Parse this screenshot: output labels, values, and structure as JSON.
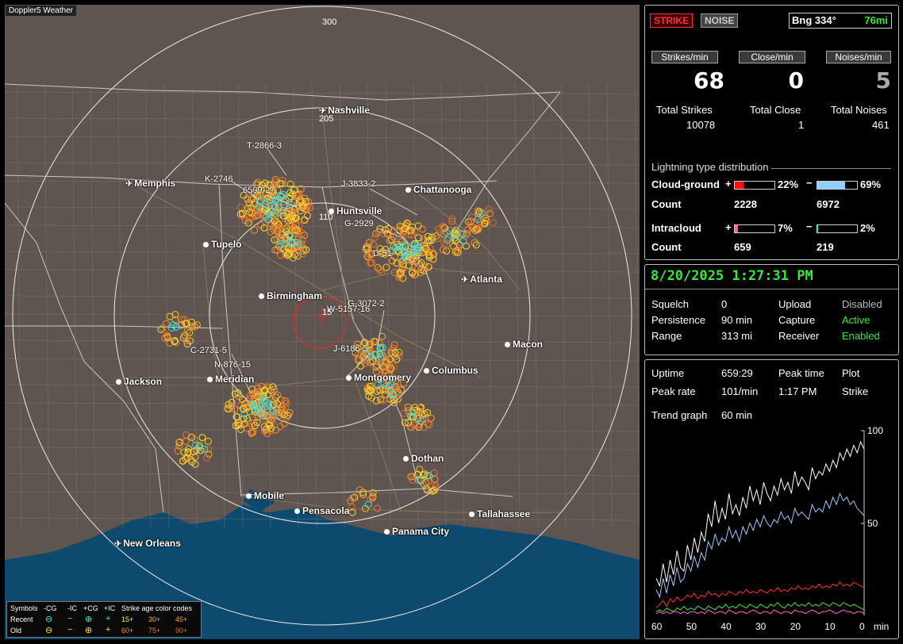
{
  "brand": "Doppler5 Weather",
  "map": {
    "range_rings": [
      "300",
      "205",
      "110",
      "15"
    ],
    "cities": [
      {
        "name": "Nashville",
        "type": "airport"
      },
      {
        "name": "Memphis",
        "type": "airport"
      },
      {
        "name": "Chattanooga",
        "type": "city"
      },
      {
        "name": "Huntsville",
        "type": "city"
      },
      {
        "name": "Tupelo",
        "type": "city"
      },
      {
        "name": "Atlanta",
        "type": "airport"
      },
      {
        "name": "Birmingham",
        "type": "city"
      },
      {
        "name": "Macon",
        "type": "city"
      },
      {
        "name": "Jackson",
        "type": "city"
      },
      {
        "name": "Meridian",
        "type": "city"
      },
      {
        "name": "Montgomery",
        "type": "city"
      },
      {
        "name": "Columbus",
        "type": "city"
      },
      {
        "name": "Dothan",
        "type": "city"
      },
      {
        "name": "Mobile",
        "type": "city"
      },
      {
        "name": "Pensacola",
        "type": "city"
      },
      {
        "name": "Tallahassee",
        "type": "city"
      },
      {
        "name": "Panama City",
        "type": "city"
      },
      {
        "name": "New Orleans",
        "type": "airport"
      }
    ],
    "tracks": [
      "T-2866-3",
      "K-2746",
      "6599-27",
      "J-3833-2",
      "G-2929",
      "D-51",
      "G-3072-2",
      "W-5157-16",
      "J-6186-5",
      "C-2731-5",
      "N-876-15"
    ]
  },
  "legend": {
    "row0": [
      "Symbols",
      "-CG",
      "-IC",
      "+CG",
      "+IC",
      "Strike age color codes"
    ],
    "recent_label": "Recent",
    "old_label": "Old",
    "recent_ages": [
      "15+",
      "30+",
      "45+"
    ],
    "old_ages": [
      "60+",
      "75+",
      "90+"
    ]
  },
  "status": {
    "strike_btn": "STRIKE",
    "noise_btn": "NOISE",
    "bearing": "Bng 334°",
    "distance": "76mi",
    "cols": [
      {
        "caption": "Strikes/min",
        "value": "68",
        "total_label": "Total Strikes",
        "total": "10078"
      },
      {
        "caption": "Close/min",
        "value": "0",
        "total_label": "Total Close",
        "total": "1"
      },
      {
        "caption": "Noises/min",
        "value": "5",
        "total_label": "Total Noises",
        "total": "461"
      }
    ],
    "dist_title": "Lightning type distribution",
    "cg_label": "Cloud-ground",
    "ic_label": "Intracloud",
    "count_label": "Count",
    "cg_pos_pct": "22%",
    "cg_neg_pct": "69%",
    "cg_pos_count": "2228",
    "cg_neg_count": "6972",
    "ic_pos_pct": "7%",
    "ic_neg_pct": "2%",
    "ic_pos_count": "659",
    "ic_neg_count": "219",
    "cg_pos_frac": 0.22,
    "cg_neg_frac": 0.69,
    "ic_pos_frac": 0.07,
    "ic_neg_frac": 0.02
  },
  "settings": {
    "datetime": "8/20/2025 1:27:31 PM",
    "squelch_label": "Squelch",
    "squelch": "0",
    "persistence_label": "Persistence",
    "persistence": "90 min",
    "range_label": "Range",
    "range": "313 mi",
    "upload_label": "Upload",
    "upload": "Disabled",
    "capture_label": "Capture",
    "capture": "Active",
    "receiver_label": "Receiver",
    "receiver": "Enabled"
  },
  "stats": {
    "uptime_label": "Uptime",
    "uptime": "659:29",
    "peak_time_label": "Peak time",
    "peak_time": "1:17 PM",
    "plot_label": "Plot",
    "plot": "Strike",
    "peak_rate_label": "Peak rate",
    "peak_rate": "101/min",
    "trend_label": "Trend graph",
    "trend": "60 min"
  },
  "chart_data": {
    "type": "line",
    "xlabel": "min",
    "x_ticks": [
      "60",
      "50",
      "40",
      "30",
      "20",
      "10",
      "0"
    ],
    "y_ticks": [
      "100",
      "50"
    ],
    "ylim": [
      0,
      100
    ],
    "xlim": [
      60,
      0
    ],
    "series": [
      {
        "color": "#ffffff",
        "values": [
          20,
          16,
          28,
          18,
          30,
          22,
          35,
          26,
          24,
          38,
          30,
          42,
          34,
          45,
          40,
          55,
          48,
          62,
          50,
          58,
          52,
          66,
          55,
          60,
          54,
          64,
          58,
          70,
          62,
          68,
          60,
          72,
          66,
          62,
          70,
          65,
          74,
          68,
          72,
          66,
          78,
          70,
          75,
          72,
          68,
          80,
          74,
          78,
          76,
          82,
          78,
          84,
          80,
          88,
          84,
          90,
          86,
          92,
          88,
          94,
          90
        ]
      },
      {
        "color": "#9ec8ff",
        "values": [
          14,
          10,
          20,
          12,
          22,
          16,
          26,
          18,
          20,
          28,
          24,
          32,
          26,
          34,
          30,
          40,
          36,
          44,
          38,
          42,
          40,
          48,
          42,
          46,
          40,
          48,
          44,
          50,
          46,
          52,
          48,
          54,
          50,
          48,
          52,
          50,
          56,
          52,
          54,
          50,
          58,
          54,
          56,
          54,
          52,
          60,
          56,
          58,
          56,
          62,
          58,
          64,
          60,
          66,
          62,
          64,
          60,
          62,
          58,
          56,
          54
        ]
      },
      {
        "color": "#ff2a2a",
        "values": [
          4,
          6,
          8,
          5,
          9,
          7,
          10,
          8,
          9,
          11,
          10,
          12,
          9,
          11,
          10,
          13,
          11,
          12,
          10,
          12,
          11,
          13,
          12,
          11,
          13,
          12,
          14,
          12,
          13,
          12,
          14,
          13,
          12,
          14,
          13,
          15,
          13,
          14,
          13,
          15,
          14,
          16,
          14,
          15,
          14,
          16,
          15,
          17,
          15,
          16,
          15,
          17,
          16,
          18,
          16,
          17,
          16,
          18,
          17,
          16,
          15
        ]
      },
      {
        "color": "#39e639",
        "values": [
          2,
          3,
          2,
          4,
          3,
          2,
          4,
          3,
          5,
          3,
          4,
          3,
          5,
          4,
          3,
          5,
          4,
          3,
          5,
          4,
          6,
          4,
          5,
          4,
          6,
          5,
          4,
          6,
          5,
          4,
          6,
          5,
          4,
          6,
          5,
          7,
          5,
          4,
          6,
          5,
          7,
          5,
          6,
          5,
          7,
          5,
          6,
          5,
          7,
          6,
          5,
          7,
          6,
          5,
          7,
          6,
          5,
          6,
          5,
          4,
          3
        ]
      },
      {
        "color": "#ff66cc",
        "values": [
          1,
          2,
          1,
          2,
          1,
          2,
          2,
          1,
          2,
          1,
          2,
          2,
          1,
          2,
          1,
          3,
          2,
          1,
          2,
          2,
          1,
          3,
          2,
          1,
          2,
          2,
          1,
          2,
          3,
          2,
          1,
          2,
          2,
          1,
          3,
          2,
          1,
          2,
          2,
          1,
          3,
          2,
          2,
          1,
          2,
          3,
          2,
          1,
          2,
          2,
          3,
          2,
          1,
          2,
          3,
          2,
          2,
          1,
          2,
          2,
          1
        ]
      }
    ]
  }
}
